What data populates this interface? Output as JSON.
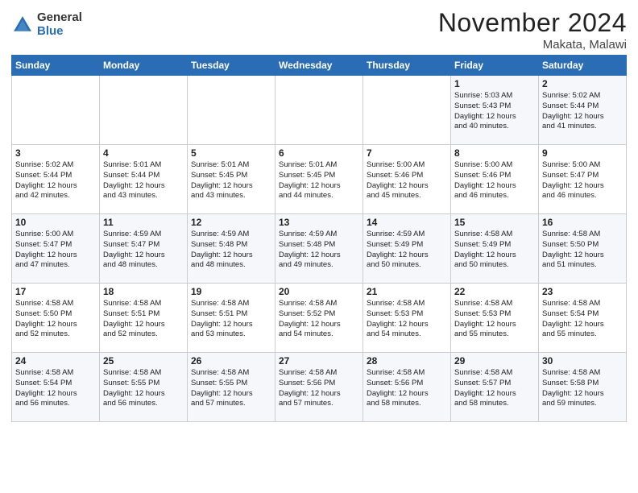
{
  "logo": {
    "general": "General",
    "blue": "Blue"
  },
  "title": "November 2024",
  "location": "Makata, Malawi",
  "days_header": [
    "Sunday",
    "Monday",
    "Tuesday",
    "Wednesday",
    "Thursday",
    "Friday",
    "Saturday"
  ],
  "weeks": [
    [
      {
        "day": "",
        "info": ""
      },
      {
        "day": "",
        "info": ""
      },
      {
        "day": "",
        "info": ""
      },
      {
        "day": "",
        "info": ""
      },
      {
        "day": "",
        "info": ""
      },
      {
        "day": "1",
        "info": "Sunrise: 5:03 AM\nSunset: 5:43 PM\nDaylight: 12 hours\nand 40 minutes."
      },
      {
        "day": "2",
        "info": "Sunrise: 5:02 AM\nSunset: 5:44 PM\nDaylight: 12 hours\nand 41 minutes."
      }
    ],
    [
      {
        "day": "3",
        "info": "Sunrise: 5:02 AM\nSunset: 5:44 PM\nDaylight: 12 hours\nand 42 minutes."
      },
      {
        "day": "4",
        "info": "Sunrise: 5:01 AM\nSunset: 5:44 PM\nDaylight: 12 hours\nand 43 minutes."
      },
      {
        "day": "5",
        "info": "Sunrise: 5:01 AM\nSunset: 5:45 PM\nDaylight: 12 hours\nand 43 minutes."
      },
      {
        "day": "6",
        "info": "Sunrise: 5:01 AM\nSunset: 5:45 PM\nDaylight: 12 hours\nand 44 minutes."
      },
      {
        "day": "7",
        "info": "Sunrise: 5:00 AM\nSunset: 5:46 PM\nDaylight: 12 hours\nand 45 minutes."
      },
      {
        "day": "8",
        "info": "Sunrise: 5:00 AM\nSunset: 5:46 PM\nDaylight: 12 hours\nand 46 minutes."
      },
      {
        "day": "9",
        "info": "Sunrise: 5:00 AM\nSunset: 5:47 PM\nDaylight: 12 hours\nand 46 minutes."
      }
    ],
    [
      {
        "day": "10",
        "info": "Sunrise: 5:00 AM\nSunset: 5:47 PM\nDaylight: 12 hours\nand 47 minutes."
      },
      {
        "day": "11",
        "info": "Sunrise: 4:59 AM\nSunset: 5:47 PM\nDaylight: 12 hours\nand 48 minutes."
      },
      {
        "day": "12",
        "info": "Sunrise: 4:59 AM\nSunset: 5:48 PM\nDaylight: 12 hours\nand 48 minutes."
      },
      {
        "day": "13",
        "info": "Sunrise: 4:59 AM\nSunset: 5:48 PM\nDaylight: 12 hours\nand 49 minutes."
      },
      {
        "day": "14",
        "info": "Sunrise: 4:59 AM\nSunset: 5:49 PM\nDaylight: 12 hours\nand 50 minutes."
      },
      {
        "day": "15",
        "info": "Sunrise: 4:58 AM\nSunset: 5:49 PM\nDaylight: 12 hours\nand 50 minutes."
      },
      {
        "day": "16",
        "info": "Sunrise: 4:58 AM\nSunset: 5:50 PM\nDaylight: 12 hours\nand 51 minutes."
      }
    ],
    [
      {
        "day": "17",
        "info": "Sunrise: 4:58 AM\nSunset: 5:50 PM\nDaylight: 12 hours\nand 52 minutes."
      },
      {
        "day": "18",
        "info": "Sunrise: 4:58 AM\nSunset: 5:51 PM\nDaylight: 12 hours\nand 52 minutes."
      },
      {
        "day": "19",
        "info": "Sunrise: 4:58 AM\nSunset: 5:51 PM\nDaylight: 12 hours\nand 53 minutes."
      },
      {
        "day": "20",
        "info": "Sunrise: 4:58 AM\nSunset: 5:52 PM\nDaylight: 12 hours\nand 54 minutes."
      },
      {
        "day": "21",
        "info": "Sunrise: 4:58 AM\nSunset: 5:53 PM\nDaylight: 12 hours\nand 54 minutes."
      },
      {
        "day": "22",
        "info": "Sunrise: 4:58 AM\nSunset: 5:53 PM\nDaylight: 12 hours\nand 55 minutes."
      },
      {
        "day": "23",
        "info": "Sunrise: 4:58 AM\nSunset: 5:54 PM\nDaylight: 12 hours\nand 55 minutes."
      }
    ],
    [
      {
        "day": "24",
        "info": "Sunrise: 4:58 AM\nSunset: 5:54 PM\nDaylight: 12 hours\nand 56 minutes."
      },
      {
        "day": "25",
        "info": "Sunrise: 4:58 AM\nSunset: 5:55 PM\nDaylight: 12 hours\nand 56 minutes."
      },
      {
        "day": "26",
        "info": "Sunrise: 4:58 AM\nSunset: 5:55 PM\nDaylight: 12 hours\nand 57 minutes."
      },
      {
        "day": "27",
        "info": "Sunrise: 4:58 AM\nSunset: 5:56 PM\nDaylight: 12 hours\nand 57 minutes."
      },
      {
        "day": "28",
        "info": "Sunrise: 4:58 AM\nSunset: 5:56 PM\nDaylight: 12 hours\nand 58 minutes."
      },
      {
        "day": "29",
        "info": "Sunrise: 4:58 AM\nSunset: 5:57 PM\nDaylight: 12 hours\nand 58 minutes."
      },
      {
        "day": "30",
        "info": "Sunrise: 4:58 AM\nSunset: 5:58 PM\nDaylight: 12 hours\nand 59 minutes."
      }
    ]
  ]
}
